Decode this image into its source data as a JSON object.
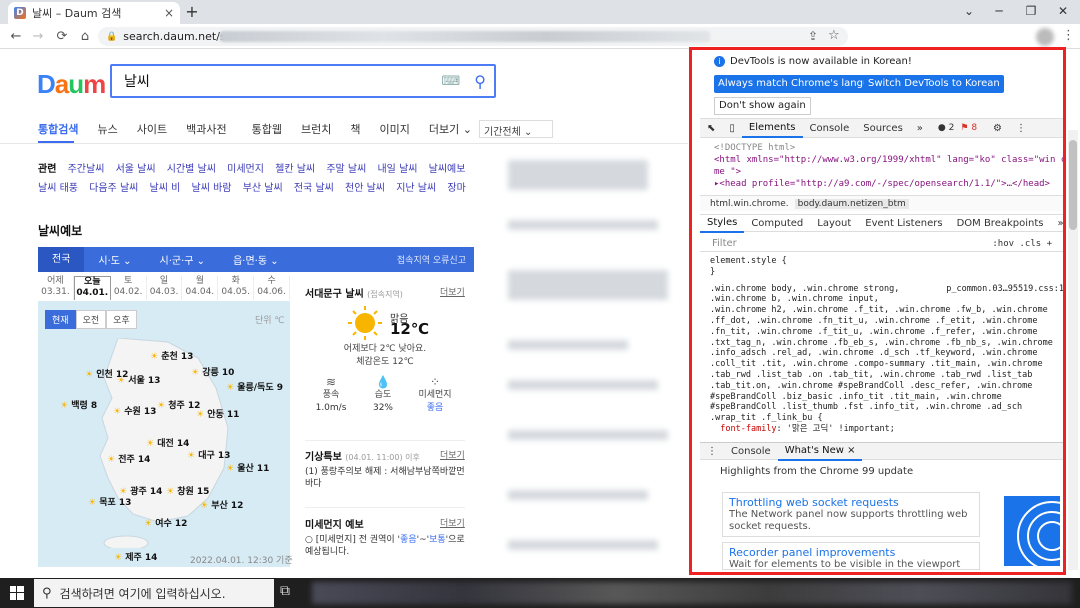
{
  "browser": {
    "tab_title": "날씨 – Daum 검색",
    "tab_close": "×",
    "new_tab": "+",
    "url": "search.daum.net/sear",
    "nav": {
      "back": "←",
      "forward": "→",
      "reload": "⟳",
      "home": "⌂"
    },
    "window": {
      "chevron": "⌄",
      "min": "─",
      "max": "❐",
      "close": "✕"
    }
  },
  "daum": {
    "logo": "Daum",
    "search_value": "날씨",
    "tabs": [
      "통합검색",
      "뉴스",
      "사이트",
      "백과사전",
      "통합웹",
      "브런치",
      "책",
      "이미지",
      "더보기 ⌄"
    ],
    "period": "기간전체 ⌄",
    "related_label": "관련",
    "related": [
      "주간날씨",
      "서울 날씨",
      "시간별 날씨",
      "미세먼지",
      "첼칸 날씨",
      "주말 날씨",
      "내일 날씨",
      "날씨예보",
      "날씨 태풍",
      "다음주 날씨",
      "날씨 비",
      "날씨 바람",
      "부산 날씨",
      "전국 날씨",
      "천안 날씨",
      "지난 날씨",
      "장마"
    ],
    "section_title": "날씨예보",
    "regions": [
      "전국",
      "시·도 ⌄",
      "시·군·구 ⌄",
      "읍·면·동 ⌄"
    ],
    "region_error": "접속지역 오류신고",
    "days": [
      {
        "d": "어제",
        "date": "03.31."
      },
      {
        "d": "오늘",
        "date": "04.01."
      },
      {
        "d": "토",
        "date": "04.02."
      },
      {
        "d": "일",
        "date": "04.03."
      },
      {
        "d": "월",
        "date": "04.04."
      },
      {
        "d": "화",
        "date": "04.05."
      },
      {
        "d": "수",
        "date": "04.06."
      }
    ],
    "segments": [
      "현재",
      "오전",
      "오후"
    ],
    "unit": "단위 ℃",
    "cities": [
      {
        "name": "춘천",
        "temp": "13"
      },
      {
        "name": "인천",
        "temp": "12"
      },
      {
        "name": "서울",
        "temp": "13"
      },
      {
        "name": "강릉",
        "temp": "10"
      },
      {
        "name": "울릉/독도",
        "temp": "9"
      },
      {
        "name": "백령",
        "temp": "8"
      },
      {
        "name": "수원",
        "temp": "13"
      },
      {
        "name": "청주",
        "temp": "12"
      },
      {
        "name": "안동",
        "temp": "11"
      },
      {
        "name": "대전",
        "temp": "14"
      },
      {
        "name": "대구",
        "temp": "13"
      },
      {
        "name": "전주",
        "temp": "14"
      },
      {
        "name": "울산",
        "temp": "11"
      },
      {
        "name": "광주",
        "temp": "14"
      },
      {
        "name": "창원",
        "temp": "15"
      },
      {
        "name": "목포",
        "temp": "13"
      },
      {
        "name": "부산",
        "temp": "12"
      },
      {
        "name": "여수",
        "temp": "12"
      },
      {
        "name": "제주",
        "temp": "14"
      }
    ],
    "map_date": "2022.04.01. 12:30 기준",
    "current": {
      "city": "서대문구 날씨",
      "city_sub": "(접속지역)",
      "more": "더보기",
      "cond": "맑음",
      "temp": "12℃",
      "compare": "어제보다 2℃ 낮아요.",
      "feels": "체감온도 12℃",
      "wind_label": "풍속",
      "wind_val": "1.0m/s",
      "hum_label": "습도",
      "hum_val": "32%",
      "dust_label": "미세먼지",
      "dust_val": "좋음"
    },
    "special": {
      "title": "기상특보",
      "sub": "(04.01. 11:00) 이후",
      "more": "더보기",
      "body": "(1) 풍랑주의보 해제 : 서해남부남쪽바깥먼바다"
    },
    "dust_forecast": {
      "title": "미세먼지 예보",
      "more": "더보기",
      "body_pre": "○ [미세먼지] 전 권역이 '",
      "good1": "좋음",
      "mid": "'~'",
      "good2": "보통",
      "body_post": "'으로 예상됩니다."
    }
  },
  "devtools": {
    "info": "DevTools is now available in Korean!",
    "btn_match": "Always match Chrome's language",
    "btn_switch": "Switch DevTools to Korean",
    "btn_dont": "Don't show again",
    "tabs": [
      "Elements",
      "Console",
      "Sources",
      "»"
    ],
    "errors": "2",
    "warnings": "8",
    "dom": {
      "doctype": "<!DOCTYPE html>",
      "html_line": "<html xmlns=\"http://www.w3.org/1999/xhtml\" lang=\"ko\" class=\"win chro",
      "html_line2": "me \">",
      "head_line": "▸<head profile=\"http://a9.com/-/spec/opensearch/1.1/\">…</head>"
    },
    "crumbs": [
      "html.win.chrome.",
      "body.daum.netizen_btm"
    ],
    "style_tabs": [
      "Styles",
      "Computed",
      "Layout",
      "Event Listeners",
      "DOM Breakpoints",
      "»"
    ],
    "filter": "Filter",
    "filter_right": ":hov  .cls  +",
    "element_style": "element.style {\n}",
    "source": "p_common.03…95519.css:1",
    "rule": ".win.chrome body, .win.chrome strong,\n.win.chrome b, .win.chrome input,\n.win.chrome h2, .win.chrome .f_tit, .win.chrome .fw_b, .win.chrome\n.ff_dot, .win.chrome .fn_tit_u, .win.chrome .f_etit, .win.chrome\n.fn_tit, .win.chrome .f_tit_u, .win.chrome .f_refer, .win.chrome\n.txt_tag_n, .win.chrome .fb_eb_s, .win.chrome .fb_nb_s, .win.chrome\n.info_adsch .rel_ad, .win.chrome .d_sch .tf_keyword, .win.chrome\n.coll_tit .tit, .win.chrome .compo-summary .tit_main, .win.chrome\n.tab_rwd .list_tab .on .tab_tit, .win.chrome .tab_rwd .list_tab\n.tab_tit.on, .win.chrome #speBrandColl .desc_refer, .win.chrome\n#speBrandColl .biz_basic .info_tit .tit_main, .win.chrome\n#speBrandColl .list_thumb .fst .info_tit, .win.chrome .ad_sch\n.wrap_tit .f_link_bu {",
    "prop": "font-family",
    "propval": ": '맑은 고딕' !important;",
    "drawer_tabs": [
      "Console",
      "What's New ×"
    ],
    "highlights": "Highlights from the Chrome 99 update",
    "card1_title": "Throttling web socket requests",
    "card1_body": "The Network panel now supports throttling web socket requests.",
    "card2_title": "Recorder panel improvements",
    "card2_body": "Wait for elements to be visible in the viewport"
  },
  "taskbar": {
    "search": "검색하려면 여기에 입력하십시오.",
    "taskview": "⧉"
  },
  "colors": {
    "accent": "#3a6df0",
    "devtools_blue": "#1a73e8",
    "highlight_box": "#e22"
  }
}
